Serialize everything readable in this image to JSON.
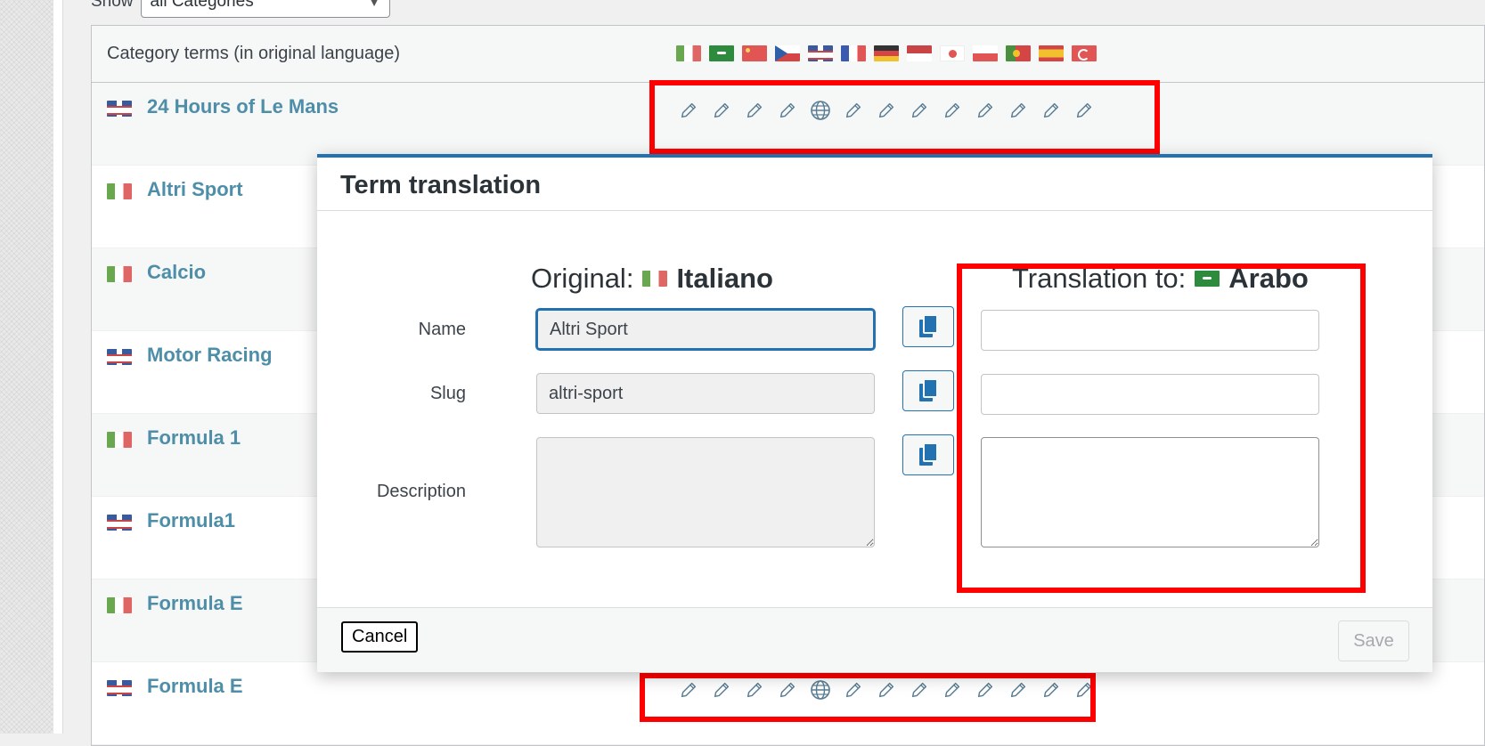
{
  "filter": {
    "label": "Show",
    "selected": "all Categories"
  },
  "table": {
    "header_label": "Category terms (in original language)",
    "language_flags": [
      "it",
      "ar",
      "cn",
      "cz",
      "gb",
      "fr",
      "de",
      "id",
      "jp",
      "pl",
      "pt",
      "es",
      "tr"
    ],
    "rows": [
      {
        "flag": "gb",
        "name": "24 Hours of Le Mans"
      },
      {
        "flag": "it",
        "name": "Altri Sport"
      },
      {
        "flag": "it",
        "name": "Calcio"
      },
      {
        "flag": "gb",
        "name": "Motor Racing"
      },
      {
        "flag": "it",
        "name": "Formula 1"
      },
      {
        "flag": "gb",
        "name": "Formula1"
      },
      {
        "flag": "it",
        "name": "Formula E"
      },
      {
        "flag": "gb",
        "name": "Formula E"
      }
    ],
    "row_icons": [
      "pencil-icon",
      "pencil-icon",
      "pencil-icon",
      "pencil-icon",
      "globe-icon",
      "pencil-icon",
      "pencil-icon",
      "pencil-icon",
      "pencil-icon",
      "pencil-icon",
      "pencil-icon",
      "pencil-icon",
      "pencil-icon"
    ]
  },
  "modal": {
    "title": "Term translation",
    "original_prefix": "Original:",
    "original_language": "Italiano",
    "translation_prefix": "Translation to:",
    "translation_language": "Arabo",
    "labels": {
      "name": "Name",
      "slug": "Slug",
      "description": "Description"
    },
    "original": {
      "name": "Altri Sport",
      "slug": "altri-sport",
      "description": ""
    },
    "translation": {
      "name": "",
      "slug": "",
      "description": ""
    },
    "cancel_label": "Cancel",
    "save_label": "Save"
  },
  "colors": {
    "highlight": "#ff0000",
    "link": "#4e8ea8",
    "primary": "#2271b1"
  }
}
